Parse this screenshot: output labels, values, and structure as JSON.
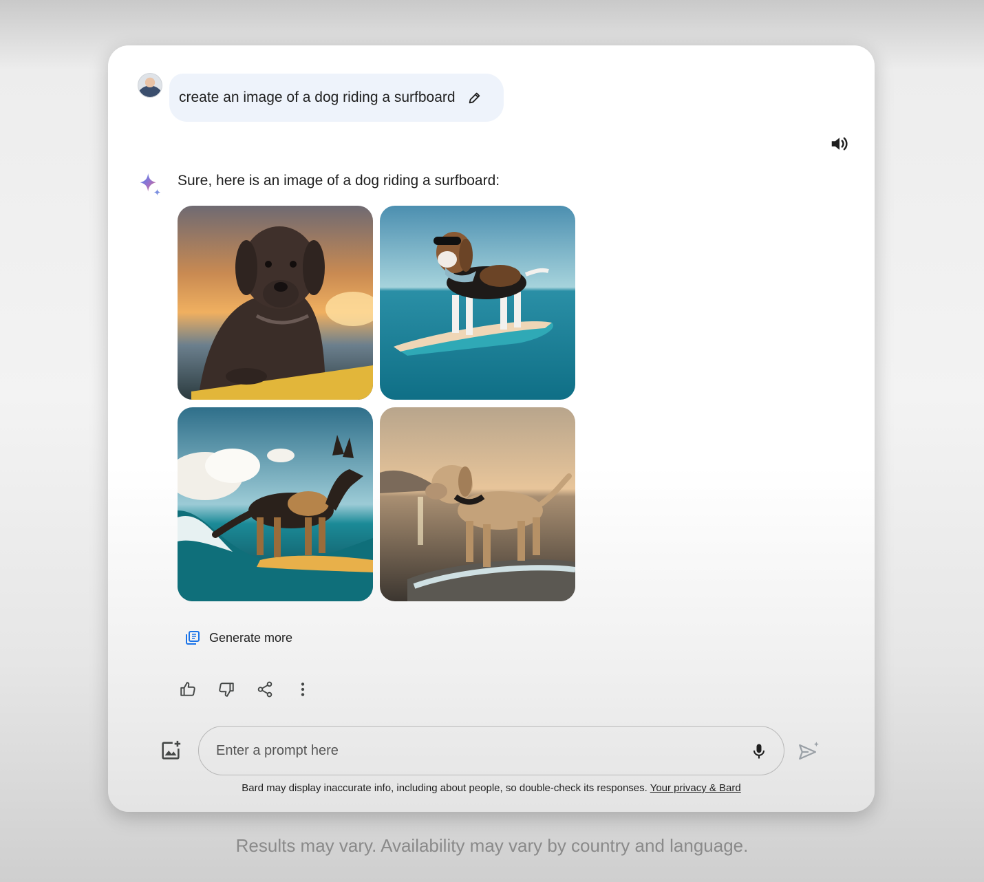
{
  "user_message": {
    "text": "create an image of a dog riding a surfboard",
    "avatar_icon": "user-avatar",
    "edit_icon": "pencil-icon"
  },
  "response": {
    "text": "Sure, here is an image of a dog riding a surfboard:",
    "assistant_icon": "bard-sparkle-icon",
    "read_aloud_icon": "speaker-icon",
    "images": [
      {
        "icon": "image-dog-labrador-sunset"
      },
      {
        "icon": "image-dog-beagle-sunglasses"
      },
      {
        "icon": "image-dog-german-shepherd-wave"
      },
      {
        "icon": "image-dog-retriever-golden-hour"
      }
    ],
    "generate_more_label": "Generate more",
    "actions": [
      "thumbs-up-icon",
      "thumbs-down-icon",
      "share-icon",
      "more-vert-icon"
    ]
  },
  "composer": {
    "placeholder": "Enter a prompt here",
    "upload_icon": "add-image-icon",
    "mic_icon": "mic-icon",
    "send_icon": "send-icon"
  },
  "disclaimer": {
    "text": "Bard may display inaccurate info, including about people, so double-check its responses.",
    "link_label": "Your privacy & Bard"
  },
  "footer_caption": "Results may vary. Availability may vary by country and language.",
  "colors": {
    "user_bubble": "#eef3fb",
    "bard_blue": "#4285f4",
    "bard_red": "#d96570",
    "icon_gray": "#444746"
  }
}
